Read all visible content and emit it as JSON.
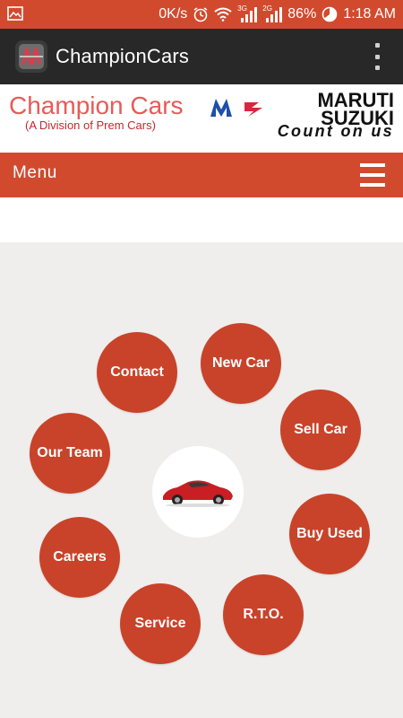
{
  "status_bar": {
    "speed": "0K/s",
    "signal_3g": "3G",
    "signal_2g": "2G",
    "battery": "86%",
    "time": "1:18 AM"
  },
  "action_bar": {
    "title": "ChampionCars"
  },
  "banner": {
    "brand_title": "Champion Cars",
    "brand_subtitle": "(A Division of Prem Cars)",
    "partner_name_line1": "MARUTI",
    "partner_name_line2": "SUZUKI",
    "tagline": "Count on us"
  },
  "menu": {
    "label": "Menu"
  },
  "circle_menu": {
    "contact": "Contact",
    "new_car": "New Car",
    "sell_car": "Sell Car",
    "our_team": "Our Team",
    "buy_used": "Buy Used",
    "careers": "Careers",
    "service": "Service",
    "rto": "R.T.O."
  },
  "icons": {
    "picture": "picture-icon",
    "alarm": "alarm-icon",
    "wifi": "wifi-icon",
    "signal": "signal-icon",
    "battery": "battery-icon",
    "app": "app-logo-icon",
    "overflow": "overflow-menu-icon",
    "hamburger": "hamburger-icon",
    "car": "car-icon"
  },
  "colors": {
    "accent": "#d24a2e",
    "button": "#c8432a",
    "action_bar": "#282828"
  }
}
